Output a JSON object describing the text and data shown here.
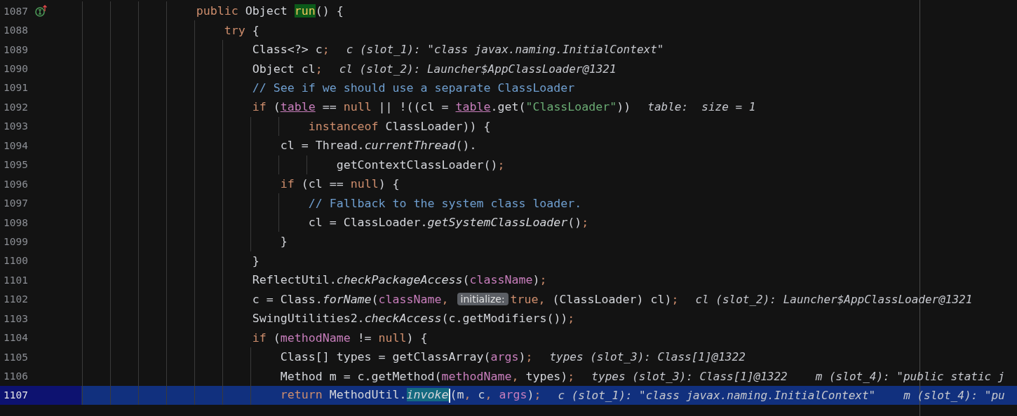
{
  "editor": {
    "lines": [
      {
        "number": "1087",
        "highlighted": false,
        "implements_marker": true,
        "segments": [
          {
            "kind": "code",
            "tokens": [
              {
                "kind": "keyword",
                "text": "                public"
              },
              {
                "kind": "plain",
                "text": " Object "
              },
              {
                "kind": "declaration",
                "text": "run"
              },
              {
                "kind": "plain",
                "text": "() {"
              }
            ]
          }
        ]
      },
      {
        "number": "1088",
        "highlighted": false,
        "segments": [
          {
            "kind": "code",
            "tokens": [
              {
                "kind": "keyword",
                "text": "                    try"
              },
              {
                "kind": "plain",
                "text": " {"
              }
            ]
          }
        ]
      },
      {
        "number": "1089",
        "highlighted": false,
        "segments": [
          {
            "kind": "code",
            "tokens": [
              {
                "kind": "plain",
                "text": "                        Class<?> c"
              },
              {
                "kind": "punct",
                "text": ";"
              }
            ]
          },
          {
            "kind": "hint",
            "text": "c (slot_1): \"class javax.naming.InitialContext\""
          }
        ]
      },
      {
        "number": "1090",
        "highlighted": false,
        "segments": [
          {
            "kind": "code",
            "tokens": [
              {
                "kind": "plain",
                "text": "                        Object cl"
              },
              {
                "kind": "punct",
                "text": ";"
              }
            ]
          },
          {
            "kind": "hint",
            "text": "cl (slot_2): Launcher$AppClassLoader@1321"
          }
        ]
      },
      {
        "number": "1091",
        "highlighted": false,
        "segments": [
          {
            "kind": "code",
            "tokens": [
              {
                "kind": "comment",
                "text": "                        // See if we should use a separate ClassLoader"
              }
            ]
          }
        ]
      },
      {
        "number": "1092",
        "highlighted": false,
        "segments": [
          {
            "kind": "code",
            "tokens": [
              {
                "kind": "keyword",
                "text": "                        if"
              },
              {
                "kind": "plain",
                "text": " ("
              },
              {
                "kind": "field",
                "text": "table"
              },
              {
                "kind": "plain",
                "text": " == "
              },
              {
                "kind": "keyword",
                "text": "null"
              },
              {
                "kind": "plain",
                "text": " || !((cl = "
              },
              {
                "kind": "field",
                "text": "table"
              },
              {
                "kind": "plain",
                "text": ".get("
              },
              {
                "kind": "string",
                "text": "\"ClassLoader\""
              },
              {
                "kind": "plain",
                "text": "))"
              }
            ]
          },
          {
            "kind": "hint",
            "text": "table:  size = 1"
          }
        ]
      },
      {
        "number": "1093",
        "highlighted": false,
        "segments": [
          {
            "kind": "code",
            "tokens": [
              {
                "kind": "keyword",
                "text": "                                instanceof"
              },
              {
                "kind": "plain",
                "text": " ClassLoader)) {"
              }
            ]
          }
        ]
      },
      {
        "number": "1094",
        "highlighted": false,
        "segments": [
          {
            "kind": "code",
            "tokens": [
              {
                "kind": "plain",
                "text": "                            cl = Thread."
              },
              {
                "kind": "call",
                "text": "currentThread"
              },
              {
                "kind": "plain",
                "text": "()."
              }
            ]
          }
        ]
      },
      {
        "number": "1095",
        "highlighted": false,
        "segments": [
          {
            "kind": "code",
            "tokens": [
              {
                "kind": "plain",
                "text": "                                    getContextClassLoader()"
              },
              {
                "kind": "punct",
                "text": ";"
              }
            ]
          }
        ]
      },
      {
        "number": "1096",
        "highlighted": false,
        "segments": [
          {
            "kind": "code",
            "tokens": [
              {
                "kind": "keyword",
                "text": "                            if"
              },
              {
                "kind": "plain",
                "text": " (cl == "
              },
              {
                "kind": "keyword",
                "text": "null"
              },
              {
                "kind": "plain",
                "text": ") {"
              }
            ]
          }
        ]
      },
      {
        "number": "1097",
        "highlighted": false,
        "segments": [
          {
            "kind": "code",
            "tokens": [
              {
                "kind": "comment",
                "text": "                                // Fallback to the system class loader."
              }
            ]
          }
        ]
      },
      {
        "number": "1098",
        "highlighted": false,
        "segments": [
          {
            "kind": "code",
            "tokens": [
              {
                "kind": "plain",
                "text": "                                cl = ClassLoader."
              },
              {
                "kind": "call",
                "text": "getSystemClassLoader"
              },
              {
                "kind": "plain",
                "text": "()"
              },
              {
                "kind": "punct",
                "text": ";"
              }
            ]
          }
        ]
      },
      {
        "number": "1099",
        "highlighted": false,
        "segments": [
          {
            "kind": "code",
            "tokens": [
              {
                "kind": "plain",
                "text": "                            }"
              }
            ]
          }
        ]
      },
      {
        "number": "1100",
        "highlighted": false,
        "segments": [
          {
            "kind": "code",
            "tokens": [
              {
                "kind": "plain",
                "text": "                        }"
              }
            ]
          }
        ]
      },
      {
        "number": "1101",
        "highlighted": false,
        "segments": [
          {
            "kind": "code",
            "tokens": [
              {
                "kind": "plain",
                "text": "                        ReflectUtil."
              },
              {
                "kind": "call",
                "text": "checkPackageAccess"
              },
              {
                "kind": "plain",
                "text": "("
              },
              {
                "kind": "param",
                "text": "className"
              },
              {
                "kind": "plain",
                "text": ")"
              },
              {
                "kind": "punct",
                "text": ";"
              }
            ]
          }
        ]
      },
      {
        "number": "1102",
        "highlighted": false,
        "segments": [
          {
            "kind": "code",
            "tokens": [
              {
                "kind": "plain",
                "text": "                        c = Class."
              },
              {
                "kind": "call",
                "text": "forName"
              },
              {
                "kind": "plain",
                "text": "("
              },
              {
                "kind": "param",
                "text": "className"
              },
              {
                "kind": "punct",
                "text": ","
              }
            ]
          },
          {
            "kind": "inlay",
            "text": "initialize:"
          },
          {
            "kind": "code",
            "tokens": [
              {
                "kind": "keyword",
                "text": "true"
              },
              {
                "kind": "punct",
                "text": ","
              },
              {
                "kind": "plain",
                "text": " (ClassLoader) cl)"
              },
              {
                "kind": "punct",
                "text": ";"
              }
            ]
          },
          {
            "kind": "hint",
            "text": "cl (slot_2): Launcher$AppClassLoader@1321"
          }
        ]
      },
      {
        "number": "1103",
        "highlighted": false,
        "segments": [
          {
            "kind": "code",
            "tokens": [
              {
                "kind": "plain",
                "text": "                        SwingUtilities2."
              },
              {
                "kind": "call",
                "text": "checkAccess"
              },
              {
                "kind": "plain",
                "text": "(c.getModifiers())"
              },
              {
                "kind": "punct",
                "text": ";"
              }
            ]
          }
        ]
      },
      {
        "number": "1104",
        "highlighted": false,
        "segments": [
          {
            "kind": "code",
            "tokens": [
              {
                "kind": "keyword",
                "text": "                        if"
              },
              {
                "kind": "plain",
                "text": " ("
              },
              {
                "kind": "param",
                "text": "methodName"
              },
              {
                "kind": "plain",
                "text": " != "
              },
              {
                "kind": "keyword",
                "text": "null"
              },
              {
                "kind": "plain",
                "text": ") {"
              }
            ]
          }
        ]
      },
      {
        "number": "1105",
        "highlighted": false,
        "segments": [
          {
            "kind": "code",
            "tokens": [
              {
                "kind": "plain",
                "text": "                            Class[] types = getClassArray("
              },
              {
                "kind": "param",
                "text": "args"
              },
              {
                "kind": "plain",
                "text": ")"
              },
              {
                "kind": "punct",
                "text": ";"
              }
            ]
          },
          {
            "kind": "hint",
            "text": "types (slot_3): Class[1]@1322"
          }
        ]
      },
      {
        "number": "1106",
        "highlighted": false,
        "segments": [
          {
            "kind": "code",
            "tokens": [
              {
                "kind": "plain",
                "text": "                            Method m = c.getMethod("
              },
              {
                "kind": "param",
                "text": "methodName"
              },
              {
                "kind": "punct",
                "text": ","
              },
              {
                "kind": "plain",
                "text": " types)"
              },
              {
                "kind": "punct",
                "text": ";"
              }
            ]
          },
          {
            "kind": "hint",
            "text": "types (slot_3): Class[1]@1322"
          },
          {
            "kind": "hint",
            "text": "m (slot_4): \"public static j"
          }
        ]
      },
      {
        "number": "1107",
        "highlighted": true,
        "segments": [
          {
            "kind": "code",
            "tokens": [
              {
                "kind": "keyword",
                "text": "                            return"
              },
              {
                "kind": "plain",
                "text": " MethodUtil."
              },
              {
                "kind": "found",
                "text": "invoke",
                "caret": true
              },
              {
                "kind": "plain",
                "text": "(m"
              },
              {
                "kind": "punct",
                "text": ","
              },
              {
                "kind": "plain",
                "text": " c"
              },
              {
                "kind": "punct",
                "text": ", "
              },
              {
                "kind": "param",
                "text": "args"
              },
              {
                "kind": "plain",
                "text": ")"
              },
              {
                "kind": "punct",
                "text": ";"
              }
            ]
          },
          {
            "kind": "hint",
            "text": "c (slot_1): \"class javax.naming.InitialContext\""
          },
          {
            "kind": "hint",
            "text": "m (slot_4): \"pu"
          }
        ]
      }
    ]
  }
}
